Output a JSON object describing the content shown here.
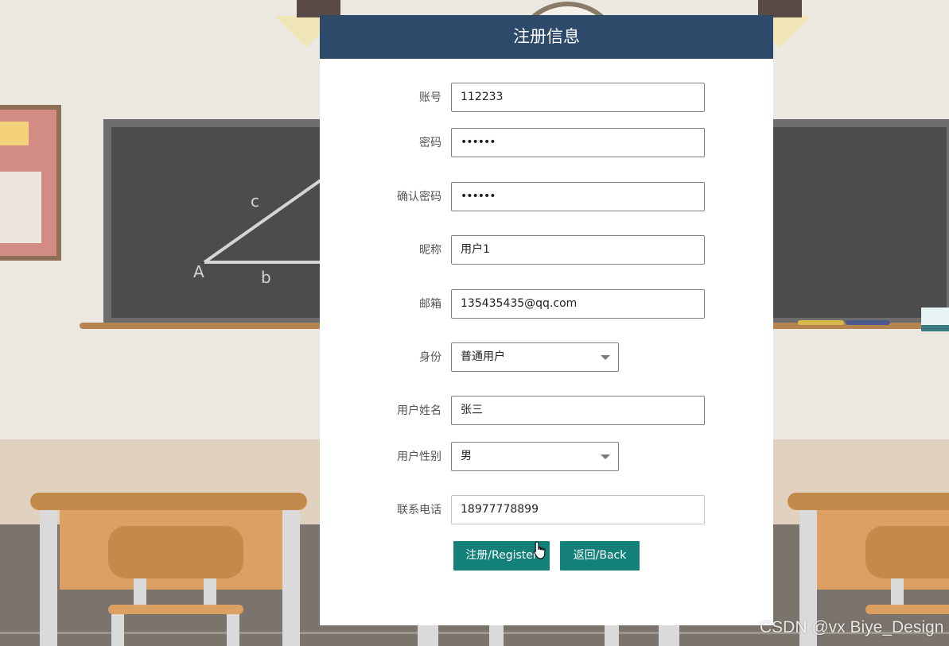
{
  "form": {
    "title": "注册信息",
    "fields": {
      "account": {
        "label": "账号",
        "value": "112233"
      },
      "password": {
        "label": "密码",
        "value": "••••••"
      },
      "confirm_password": {
        "label": "确认密码",
        "value": "••••••"
      },
      "nickname": {
        "label": "昵称",
        "value": "用户1"
      },
      "email": {
        "label": "邮箱",
        "value": "135435435@qq.com"
      },
      "identity": {
        "label": "身份",
        "value": "普通用户"
      },
      "real_name": {
        "label": "用户姓名",
        "value": "张三"
      },
      "gender": {
        "label": "用户性别",
        "value": "男"
      },
      "phone": {
        "label": "联系电话",
        "value": "18977778899"
      }
    },
    "buttons": {
      "register": "注册/Register",
      "back": "返回/Back"
    }
  },
  "watermark": "CSDN @vx Biye_Design",
  "colors": {
    "header": "#2d4a6b",
    "button": "#14807a",
    "panel": "#ffffff"
  }
}
